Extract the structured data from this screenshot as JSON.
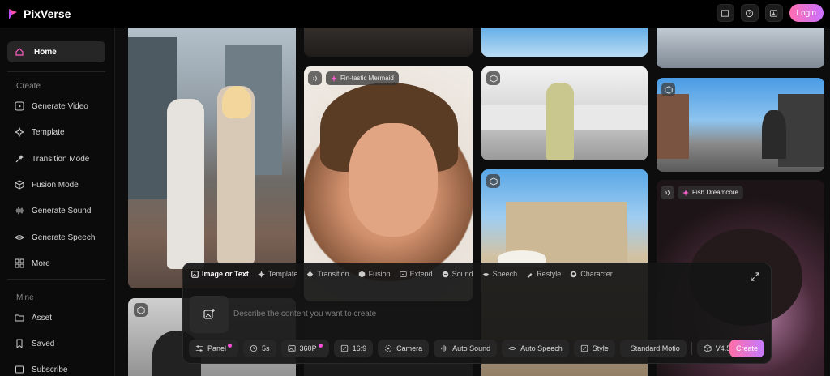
{
  "app": {
    "name": "PixVerse",
    "brand_color": "#e04fd0",
    "login_label": "Login"
  },
  "topbar": {
    "icons": [
      "book-icon",
      "help-icon",
      "download-app-icon"
    ]
  },
  "sidebar": {
    "home_label": "Home",
    "create_section": "Create",
    "create_items": [
      {
        "label": "Generate Video",
        "icon": "play-square-icon"
      },
      {
        "label": "Template",
        "icon": "template-icon"
      },
      {
        "label": "Transition Mode",
        "icon": "transition-icon"
      },
      {
        "label": "Fusion Mode",
        "icon": "cube-icon"
      },
      {
        "label": "Generate Sound",
        "icon": "waveform-icon"
      },
      {
        "label": "Generate Speech",
        "icon": "lips-icon"
      },
      {
        "label": "More",
        "icon": "grid-icon"
      }
    ],
    "mine_section": "Mine",
    "mine_items": [
      {
        "label": "Asset",
        "icon": "folder-icon"
      },
      {
        "label": "Saved",
        "icon": "bookmark-icon"
      },
      {
        "label": "Subscribe",
        "icon": "subscribe-icon"
      }
    ]
  },
  "feed": {
    "tags": [
      "Fin-tastic Mermaid",
      "Fish Dreamcore"
    ]
  },
  "composer": {
    "tabs": [
      "Image or Text",
      "Template",
      "Transition",
      "Fusion",
      "Extend",
      "Sound",
      "Speech",
      "Restyle",
      "Character"
    ],
    "active_tab": "Image or Text",
    "prompt_placeholder": "Describe the content you want to create",
    "chips": [
      "Panel",
      "5s",
      "360P",
      "16:9",
      "Camera",
      "Auto Sound",
      "Auto Speech",
      "Style",
      "Standard Motio"
    ],
    "model": "V4.5",
    "create_label": "Create",
    "accent": "#ff6fa8"
  }
}
